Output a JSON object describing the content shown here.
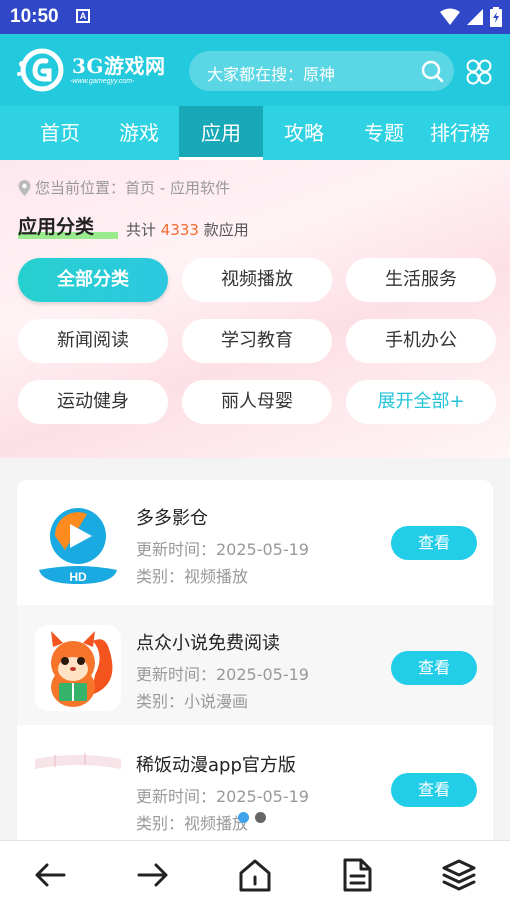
{
  "status_bar": {
    "time": "10:50",
    "notification_glyph": "A"
  },
  "header": {
    "logo_text": "3G游戏网",
    "logo_sub": "-www.gamegyy.com-",
    "search_placeholder": "大家都在搜：原神"
  },
  "nav": {
    "items": [
      {
        "label": "首页",
        "active": false
      },
      {
        "label": "游戏",
        "active": false
      },
      {
        "label": "应用",
        "active": true
      },
      {
        "label": "攻略",
        "active": false
      },
      {
        "label": "专题",
        "active": false
      },
      {
        "label": "排行榜",
        "active": false
      }
    ]
  },
  "breadcrumb": {
    "text": "您当前位置：首页 - 应用软件"
  },
  "category": {
    "title": "应用分类",
    "count_prefix": "共计",
    "count": "4333",
    "count_suffix": "款应用",
    "chips": [
      {
        "label": "全部分类",
        "active": true
      },
      {
        "label": "视频播放",
        "active": false
      },
      {
        "label": "生活服务",
        "active": false
      },
      {
        "label": "新闻阅读",
        "active": false
      },
      {
        "label": "学习教育",
        "active": false
      },
      {
        "label": "手机办公",
        "active": false
      },
      {
        "label": "运动健身",
        "active": false
      },
      {
        "label": "丽人母婴",
        "active": false
      },
      {
        "label": "展开全部+",
        "active": false
      }
    ]
  },
  "apps": [
    {
      "name": "多多影仓",
      "date": "更新时间：2025-05-19",
      "category": "类别：视频播放",
      "button": "查看",
      "icon": "hd-player-icon",
      "icon_label": "HD"
    },
    {
      "name": "点众小说免费阅读",
      "date": "更新时间：2025-05-19",
      "category": "类别：小说漫画",
      "button": "查看",
      "icon": "squirrel-reader-icon"
    },
    {
      "name": "稀饭动漫app官方版",
      "date": "更新时间：2025-05-19",
      "category": "类别：视频播放",
      "button": "查看",
      "icon": "anime-icon"
    }
  ],
  "bottom_nav": [
    "back-icon",
    "forward-icon",
    "home-icon",
    "document-icon",
    "layers-icon"
  ],
  "colors": {
    "brand": "#23c9dc",
    "nav": "#2fd2e2",
    "nav_active": "#18a8b8",
    "accent_count": "#f26b32",
    "button": "#22cde8"
  }
}
